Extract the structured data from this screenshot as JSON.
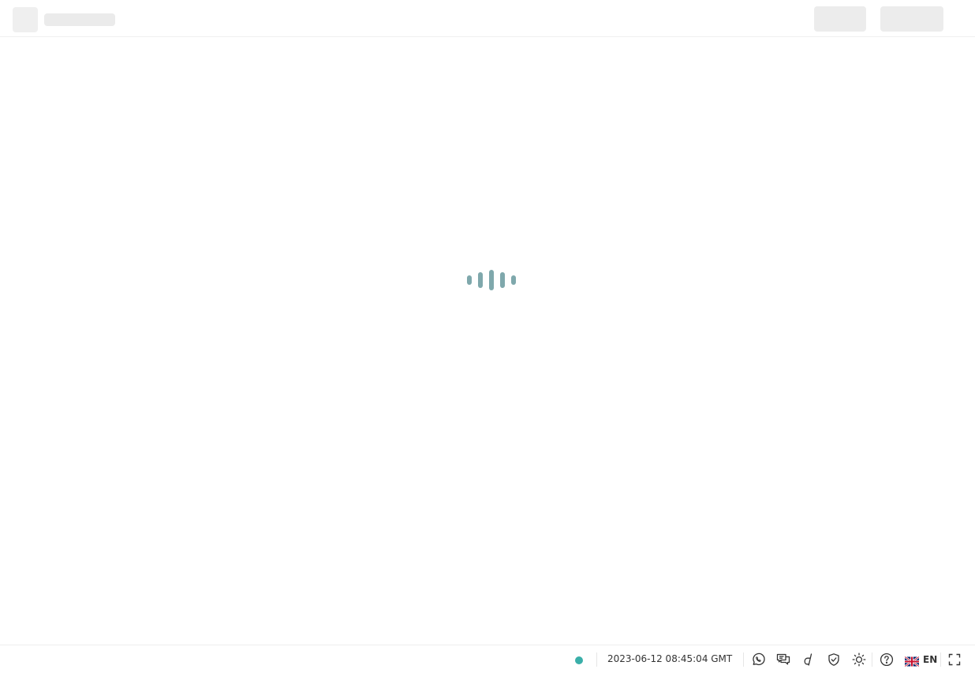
{
  "colors": {
    "accent": "#3aafa9",
    "loader": "#7fa8ac",
    "skeleton": "#ececec",
    "text": "#333333"
  },
  "header": {
    "state": "loading-skeleton"
  },
  "main": {
    "loader": {
      "icon": "loading-bars-icon",
      "state": "loading"
    }
  },
  "footer": {
    "status_icon": "connection-status-dot",
    "status_color": "#3aafa9",
    "datetime": "2023-06-12 08:45:04 GMT",
    "icons": [
      "whatsapp-icon",
      "chat-icon",
      "deriv-icon",
      "shield-icon",
      "theme-sun-icon",
      "help-icon"
    ],
    "language": {
      "flag": "uk-flag-icon",
      "code": "EN"
    },
    "fullscreen_icon": "fullscreen-icon"
  }
}
